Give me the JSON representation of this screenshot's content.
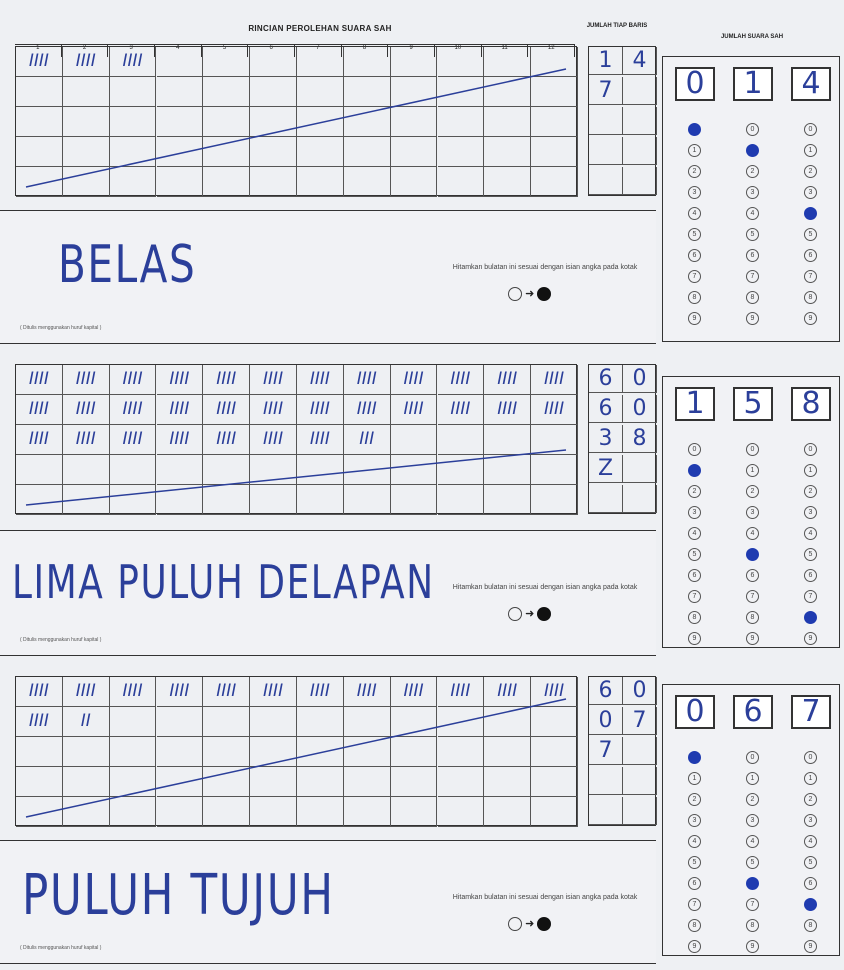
{
  "header": {
    "title": "RINCIAN PEROLEHAN SUARA SAH",
    "column_numbers": [
      "1",
      "2",
      "3",
      "4",
      "5",
      "6",
      "7",
      "8",
      "9",
      "10",
      "11",
      "12"
    ],
    "jumlah_label": "JUMLAH TIAP BARIS",
    "jumlah_suara_label": "JUMLAH SUARA SAH"
  },
  "sections": [
    {
      "rows": [
        [
          "IIII",
          "IIII",
          "IIII",
          "",
          "",
          "",
          "",
          "",
          "",
          "",
          "",
          ""
        ],
        [
          "",
          "",
          "",
          "",
          "",
          "",
          "",
          "",
          "",
          "",
          "",
          ""
        ],
        [
          "",
          "",
          "",
          "",
          "",
          "",
          "",
          "",
          "",
          "",
          "",
          ""
        ],
        [
          "",
          "",
          "",
          "",
          "",
          "",
          "",
          "",
          "",
          "",
          "",
          ""
        ],
        [
          "",
          "",
          "",
          "",
          "",
          "",
          "",
          "",
          "",
          "",
          "",
          ""
        ]
      ],
      "totals": [
        [
          "1",
          "4"
        ],
        [
          "7",
          ""
        ],
        [
          "",
          ""
        ],
        [
          "",
          ""
        ],
        [
          "",
          ""
        ]
      ],
      "words": "BELAS",
      "note": "( Ditulis menggunakan huruf kapital )",
      "instruction": "Hitamkan bulatan ini sesuai dengan isian angka pada kotak",
      "digits": [
        "0",
        "1",
        "4"
      ],
      "bubble_labels": [
        "0",
        "1",
        "2",
        "3",
        "4",
        "5",
        "6",
        "7",
        "8",
        "9"
      ],
      "filled": [
        0,
        1,
        4
      ]
    },
    {
      "rows": [
        [
          "IIII",
          "IIII",
          "IIII",
          "IIII",
          "IIII",
          "IIII",
          "IIII",
          "IIII",
          "IIII",
          "IIII",
          "IIII",
          "IIII"
        ],
        [
          "IIII",
          "IIII",
          "IIII",
          "IIII",
          "IIII",
          "IIII",
          "IIII",
          "IIII",
          "IIII",
          "IIII",
          "IIII",
          "IIII"
        ],
        [
          "IIII",
          "IIII",
          "IIII",
          "IIII",
          "IIII",
          "IIII",
          "IIII",
          "III",
          "",
          "",
          "",
          ""
        ],
        [
          "",
          "",
          "",
          "",
          "",
          "",
          "",
          "",
          "",
          "",
          "",
          ""
        ],
        [
          "",
          "",
          "",
          "",
          "",
          "",
          "",
          "",
          "",
          "",
          "",
          ""
        ]
      ],
      "totals": [
        [
          "6",
          "0"
        ],
        [
          "6",
          "0"
        ],
        [
          "3",
          "8"
        ],
        [
          "Z",
          ""
        ],
        [
          "",
          ""
        ]
      ],
      "words": "LIMA PULUH DELAPAN",
      "note": "( Ditulis menggunakan huruf kapital )",
      "instruction": "Hitamkan bulatan ini sesuai dengan isian angka pada kotak",
      "digits": [
        "1",
        "5",
        "8"
      ],
      "bubble_labels": [
        "0",
        "1",
        "2",
        "3",
        "4",
        "5",
        "6",
        "7",
        "8",
        "9"
      ],
      "filled": [
        1,
        5,
        8
      ]
    },
    {
      "rows": [
        [
          "IIII",
          "IIII",
          "IIII",
          "IIII",
          "IIII",
          "IIII",
          "IIII",
          "IIII",
          "IIII",
          "IIII",
          "IIII",
          "IIII"
        ],
        [
          "IIII",
          "II",
          "",
          "",
          "",
          "",
          "",
          "",
          "",
          "",
          "",
          ""
        ],
        [
          "",
          "",
          "",
          "",
          "",
          "",
          "",
          "",
          "",
          "",
          "",
          ""
        ],
        [
          "",
          "",
          "",
          "",
          "",
          "",
          "",
          "",
          "",
          "",
          "",
          ""
        ],
        [
          "",
          "",
          "",
          "",
          "",
          "",
          "",
          "",
          "",
          "",
          "",
          ""
        ]
      ],
      "totals": [
        [
          "6",
          "0"
        ],
        [
          "0",
          "7"
        ],
        [
          "7",
          ""
        ],
        [
          "",
          ""
        ],
        [
          "",
          ""
        ]
      ],
      "words": "PULUH TUJUH",
      "note": "( Ditulis menggunakan huruf kapital )",
      "instruction": "Hitamkan bulatan ini sesuai dengan isian angka pada kotak",
      "digits": [
        "0",
        "6",
        "7"
      ],
      "bubble_labels": [
        "0",
        "1",
        "2",
        "3",
        "4",
        "5",
        "6",
        "7",
        "8",
        "9"
      ],
      "filled": [
        0,
        6,
        7
      ]
    }
  ],
  "colors": {
    "ink": "#2b3f9a",
    "bubble_fill": "#1f3bb0"
  }
}
